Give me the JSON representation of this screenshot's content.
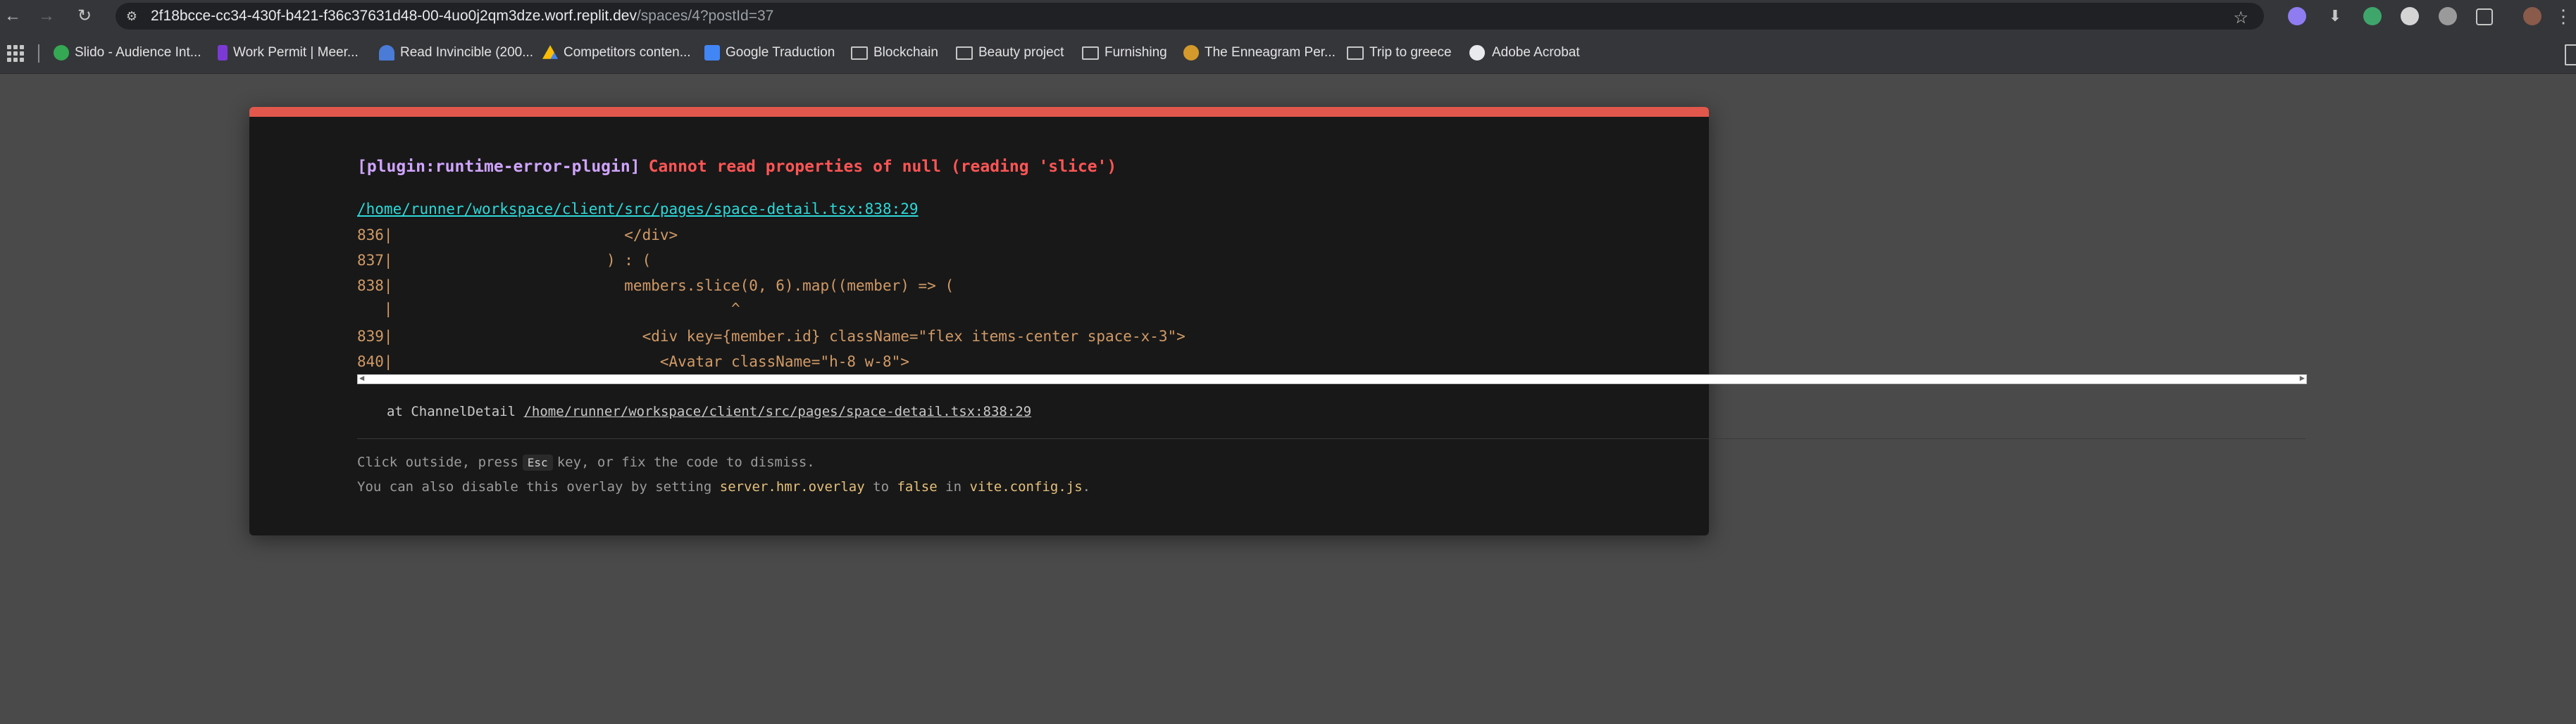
{
  "browser": {
    "url_host": "2f18bcce-cc34-430f-b421-f36c37631d48-00-4uo0j2qm3dze.worf.replit.dev",
    "url_path": "/spaces/4?postId=37",
    "bookmarks": [
      {
        "label": "Slido - Audience Int...",
        "icon": "slido-icon",
        "color": "#34a853"
      },
      {
        "label": "Work Permit | Meer...",
        "icon": "work-permit-icon",
        "color": "#7b3ad6"
      },
      {
        "label": "Read Invincible (200...",
        "icon": "invincible-icon",
        "color": "#4a7bd6"
      },
      {
        "label": "Competitors conten...",
        "icon": "google-drive-icon",
        "color": "#fbbc04"
      },
      {
        "label": "Google Traduction",
        "icon": "google-translate-icon",
        "color": "#4285f4"
      },
      {
        "label": "Blockchain",
        "icon": "folder-icon"
      },
      {
        "label": "Beauty project",
        "icon": "folder-icon"
      },
      {
        "label": "Furnishing",
        "icon": "folder-icon"
      },
      {
        "label": "The Enneagram Per...",
        "icon": "enneagram-icon",
        "color": "#d39a2b"
      },
      {
        "label": "Trip to greece",
        "icon": "folder-icon"
      },
      {
        "label": "Adobe Acrobat",
        "icon": "globe-icon"
      }
    ]
  },
  "overlay": {
    "plugin": "[plugin:runtime-error-plugin]",
    "message": "Cannot read properties of null (reading 'slice')",
    "file": "/home/runner/workspace/client/src/pages/space-detail.tsx:838:29",
    "code_lines": [
      "836|                          </div>",
      "837|                        ) : (",
      "838|                          members.slice(0, 6).map((member) => (",
      "   |                                      ^",
      "839|                            <div key={member.id} className=\"flex items-center space-x-3\">",
      "840|                              <Avatar className=\"h-8 w-8\">"
    ],
    "stack_prefix": "at ChannelDetail",
    "stack_location": "/home/runner/workspace/client/src/pages/space-detail.tsx:838:29",
    "tip1_before": "Click outside, press",
    "tip1_key": "Esc",
    "tip1_after": "key, or fix the code to dismiss.",
    "tip2_before": "You can also disable this overlay by setting",
    "tip2_setting": "server.hmr.overlay",
    "tip2_to": "to",
    "tip2_value": "false",
    "tip2_in": "in",
    "tip2_file": "vite.config.js",
    "tip2_end": "."
  }
}
